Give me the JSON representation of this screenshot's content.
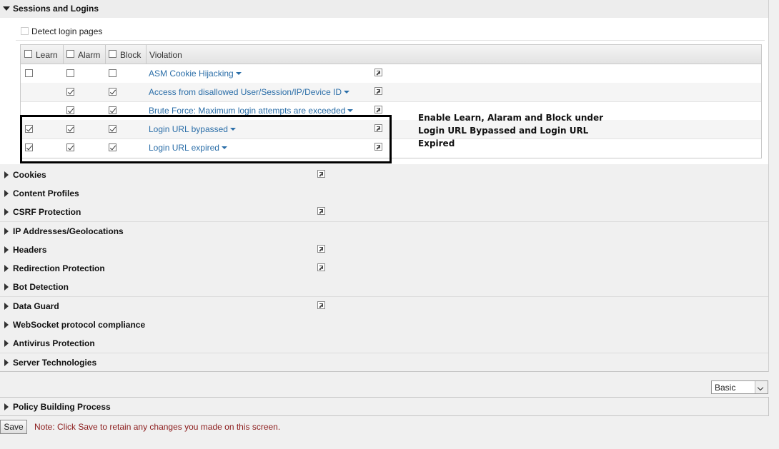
{
  "sessions_section": {
    "title": "Sessions and Logins",
    "detect_login_label": "Detect login pages",
    "detect_login_checked": false,
    "columns": {
      "learn": "Learn",
      "alarm": "Alarm",
      "block": "Block",
      "violation": "Violation"
    },
    "header_checks": {
      "learn": false,
      "alarm": false,
      "block": false
    },
    "rows": [
      {
        "violation": "ASM Cookie Hijacking",
        "learn": false,
        "alarm": false,
        "block": false,
        "learn_available": true
      },
      {
        "violation": "Access from disallowed User/Session/IP/Device ID",
        "learn": false,
        "alarm": true,
        "block": true,
        "learn_available": false
      },
      {
        "violation": "Brute Force: Maximum login attempts are exceeded",
        "learn": false,
        "alarm": true,
        "block": true,
        "learn_available": false
      },
      {
        "violation": "Login URL bypassed",
        "learn": true,
        "alarm": true,
        "block": true,
        "learn_available": true
      },
      {
        "violation": "Login URL expired",
        "learn": true,
        "alarm": true,
        "block": true,
        "learn_available": true
      }
    ]
  },
  "annotation": {
    "line1": "Enable Learn, Alaram and Block under",
    "line2": "Login URL Bypassed and Login URL",
    "line3": "Expired"
  },
  "sections": [
    {
      "label": "Cookies",
      "has_link": true
    },
    {
      "label": "Content Profiles",
      "has_link": false
    },
    {
      "label": "CSRF Protection",
      "has_link": true
    },
    {
      "label": "IP Addresses/Geolocations",
      "has_link": false
    },
    {
      "label": "Headers",
      "has_link": true
    },
    {
      "label": "Redirection Protection",
      "has_link": true
    },
    {
      "label": "Bot Detection",
      "has_link": false
    },
    {
      "label": "Data Guard",
      "has_link": true
    },
    {
      "label": "WebSocket protocol compliance",
      "has_link": false
    },
    {
      "label": "Antivirus Protection",
      "has_link": false
    },
    {
      "label": "Server Technologies",
      "has_link": false
    }
  ],
  "mode_select": {
    "value": "Basic"
  },
  "policy_building": {
    "label": "Policy Building Process"
  },
  "footer": {
    "save_label": "Save",
    "note": "Note: Click Save to retain any changes you made on this screen."
  },
  "colors": {
    "link": "#2b6ea8",
    "note": "#8b1a1a",
    "annotation_border": "#000000"
  }
}
